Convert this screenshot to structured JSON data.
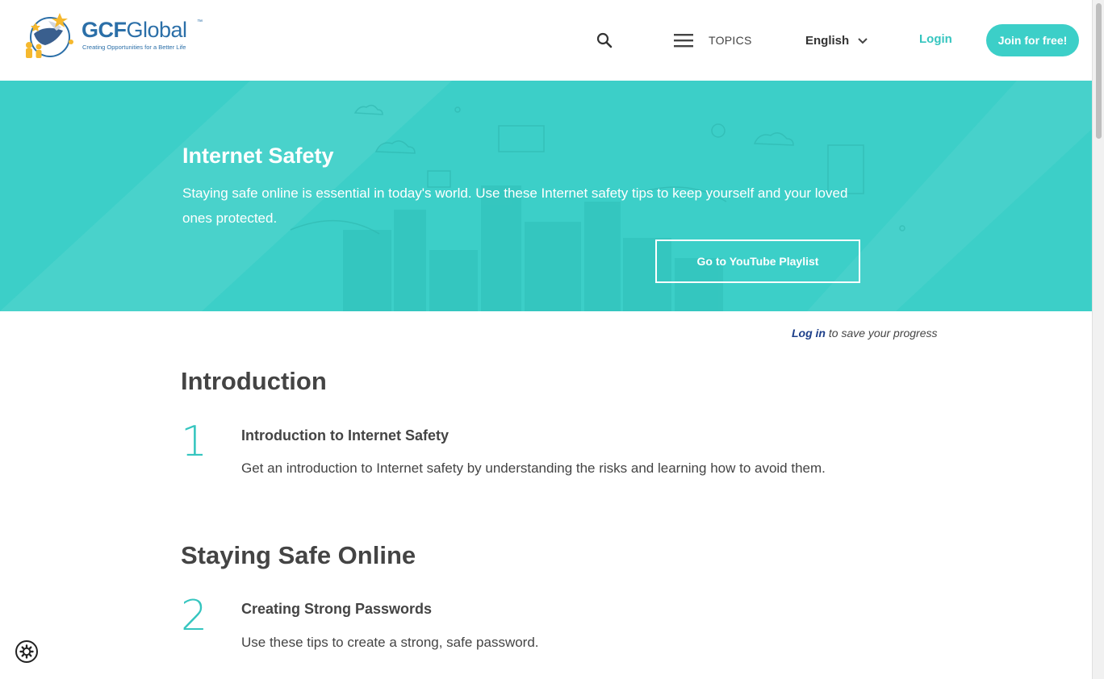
{
  "header": {
    "logo_brand": "GCFGlobal",
    "logo_brand_bold": "GCF",
    "logo_brand_light": "Global",
    "logo_tm": "™",
    "logo_tagline": "Creating Opportunities for a Better Life",
    "search_icon": "search-icon",
    "topics_label": "TOPICS",
    "language_label": "English",
    "login_label": "Login",
    "join_label": "Join for free!"
  },
  "hero": {
    "title": "Internet Safety",
    "description": "Staying safe online is essential in today's world. Use these Internet safety tips to keep yourself and your loved ones protected.",
    "playlist_button": "Go to YouTube Playlist"
  },
  "progress": {
    "login_link": "Log in",
    "suffix": " to save your progress"
  },
  "sections": [
    {
      "title": "Introduction",
      "lessons": [
        {
          "number": "1",
          "title": "Introduction to Internet Safety",
          "description": "Get an introduction to Internet safety by understanding the risks and learning how to avoid them."
        }
      ]
    },
    {
      "title": "Staying Safe Online",
      "lessons": [
        {
          "number": "2",
          "title": "Creating Strong Passwords",
          "description": "Use these tips to create a strong, safe password."
        }
      ]
    }
  ],
  "colors": {
    "accent": "#3ccfc8",
    "accent_text": "#35c5bf",
    "link_dark": "#1d3f8a",
    "logo_blue": "#2b6fa8"
  }
}
